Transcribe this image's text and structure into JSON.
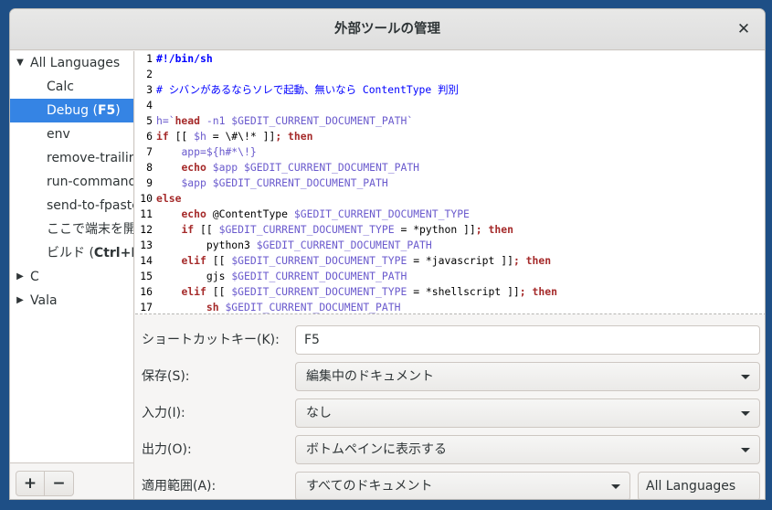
{
  "window": {
    "title": "外部ツールの管理",
    "close_label": "✕"
  },
  "tree": {
    "items": [
      {
        "label": "All Languages",
        "expanded": true,
        "level": 0
      },
      {
        "label": "Calc",
        "level": 1
      },
      {
        "label": "Debug (F5)",
        "name": "Debug",
        "shortcut": "F5",
        "level": 1,
        "selected": true
      },
      {
        "label": "env",
        "level": 1
      },
      {
        "label": "remove-trailing",
        "level": 1
      },
      {
        "label": "run-command",
        "level": 1
      },
      {
        "label": "send-to-fpaste",
        "level": 1
      },
      {
        "label": "ここで端末を開",
        "level": 1
      },
      {
        "label": "ビルド (Ctrl+B)",
        "name": "ビルド",
        "shortcut": "Ctrl+B",
        "level": 1
      },
      {
        "label": "C",
        "expanded": false,
        "level": 0
      },
      {
        "label": "Vala",
        "expanded": false,
        "level": 0
      }
    ]
  },
  "toolbar": {
    "add_label": "+",
    "remove_label": "−"
  },
  "editor": {
    "lines": [
      {
        "n": "1",
        "html": "<span class=\"sh\">#!/bin/sh</span>"
      },
      {
        "n": "2",
        "html": ""
      },
      {
        "n": "3",
        "html": "<span class=\"cm\"># シバンがあるならソレで起動、無いなら ContentType 判別</span>"
      },
      {
        "n": "4",
        "html": ""
      },
      {
        "n": "5",
        "html": "<span class=\"var\">h=`</span><span class=\"kw\">head</span><span class=\"var\"> -n1 $GEDIT_CURRENT_DOCUMENT_PATH`</span>"
      },
      {
        "n": "6",
        "html": "<span class=\"kw\">if</span><span class=\"plain\"> [[ </span><span class=\"var\">$h</span><span class=\"plain\"> = \\#\\!* ]]</span><span class=\"kw\">; then</span>"
      },
      {
        "n": "7",
        "html": "    <span class=\"var\">app=${h#*\\!}</span>"
      },
      {
        "n": "8",
        "html": "    <span class=\"kw\">echo</span><span class=\"var\"> $app $GEDIT_CURRENT_DOCUMENT_PATH</span>"
      },
      {
        "n": "9",
        "html": "    <span class=\"var\">$app $GEDIT_CURRENT_DOCUMENT_PATH</span>"
      },
      {
        "n": "10",
        "html": "<span class=\"kw\">else</span>"
      },
      {
        "n": "11",
        "html": "    <span class=\"kw\">echo</span><span class=\"plain\"> @ContentType </span><span class=\"var\">$GEDIT_CURRENT_DOCUMENT_TYPE</span>"
      },
      {
        "n": "12",
        "html": "    <span class=\"kw\">if</span><span class=\"plain\"> [[ </span><span class=\"var\">$GEDIT_CURRENT_DOCUMENT_TYPE</span><span class=\"plain\"> = *python ]]</span><span class=\"kw\">; then</span>"
      },
      {
        "n": "13",
        "html": "        <span class=\"plain\">python3 </span><span class=\"var\">$GEDIT_CURRENT_DOCUMENT_PATH</span>"
      },
      {
        "n": "14",
        "html": "    <span class=\"kw\">elif</span><span class=\"plain\"> [[ </span><span class=\"var\">$GEDIT_CURRENT_DOCUMENT_TYPE</span><span class=\"plain\"> = *javascript ]]</span><span class=\"kw\">; then</span>"
      },
      {
        "n": "15",
        "html": "        <span class=\"plain\">gjs </span><span class=\"var\">$GEDIT_CURRENT_DOCUMENT_PATH</span>"
      },
      {
        "n": "16",
        "html": "    <span class=\"kw\">elif</span><span class=\"plain\"> [[ </span><span class=\"var\">$GEDIT_CURRENT_DOCUMENT_TYPE</span><span class=\"plain\"> = *shellscript ]]</span><span class=\"kw\">; then</span>"
      },
      {
        "n": "17",
        "html": "        <span class=\"kw\">sh</span><span class=\"var\"> $GEDIT_CURRENT_DOCUMENT_PATH</span>"
      }
    ]
  },
  "form": {
    "shortcut_label": "ショートカットキー(K):",
    "shortcut_value": "F5",
    "save_label": "保存(S):",
    "save_value": "編集中のドキュメント",
    "input_label": "入力(I):",
    "input_value": "なし",
    "output_label": "出力(O):",
    "output_value": "ボトムペインに表示する",
    "scope_label": "適用範囲(A):",
    "scope_value": "すべてのドキュメント",
    "languages_value": "All Languages"
  }
}
